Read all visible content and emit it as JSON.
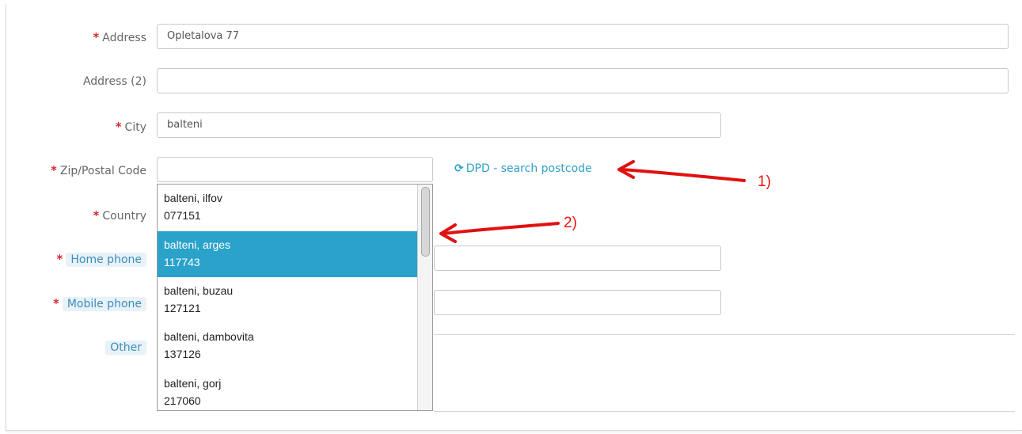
{
  "form": {
    "address": {
      "label": "Address",
      "value": "Opletalova 77"
    },
    "address2": {
      "label": "Address (2)",
      "value": ""
    },
    "city": {
      "label": "City",
      "value": "balteni"
    },
    "zip": {
      "label": "Zip/Postal Code",
      "value": ""
    },
    "country": {
      "label": "Country"
    },
    "home_phone": {
      "label": "Home phone"
    },
    "mobile_phone": {
      "label": "Mobile phone"
    },
    "other": {
      "label": "Other"
    },
    "required_mark": "*"
  },
  "dpd_link": {
    "icon": "refresh-icon",
    "label": "DPD - search postcode"
  },
  "dropdown": {
    "items": [
      {
        "place": "balteni, ilfov",
        "code": "077151"
      },
      {
        "place": "balteni, arges",
        "code": "117743"
      },
      {
        "place": "balteni, buzau",
        "code": "127121"
      },
      {
        "place": "balteni, dambovita",
        "code": "137126"
      },
      {
        "place": "balteni, gorj",
        "code": "217060"
      }
    ],
    "selected_index": 1
  },
  "annotations": {
    "a1": "1)",
    "a2": "2)"
  },
  "colors": {
    "required": "#e0252d",
    "link": "#2fa0c7",
    "selected": "#2aa2ca",
    "annotation": "#e11111"
  }
}
